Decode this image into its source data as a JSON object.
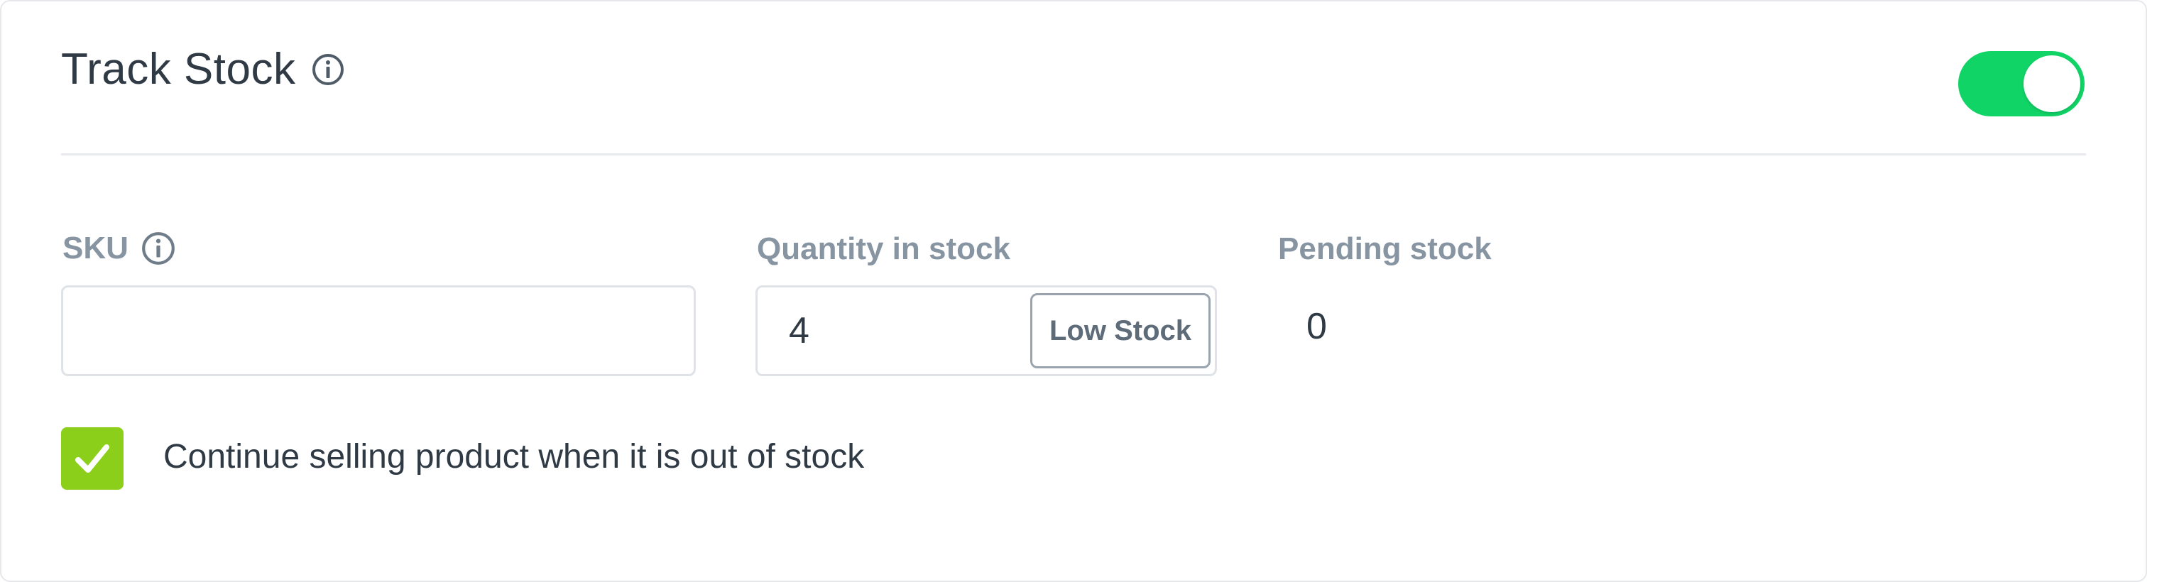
{
  "section": {
    "title": "Track Stock",
    "title_info_icon": "info-circle-icon",
    "toggle": {
      "state": "on",
      "color": "#11d467"
    }
  },
  "fields": {
    "sku": {
      "label": "SKU",
      "info_icon": "info-circle-icon",
      "value": "",
      "placeholder": ""
    },
    "quantity": {
      "label": "Quantity in stock",
      "value": "4",
      "low_stock_button": "Low Stock"
    },
    "pending": {
      "label": "Pending stock",
      "value": "0"
    }
  },
  "continue_selling": {
    "checked": true,
    "label": "Continue selling product when it is out of stock",
    "color": "#8ccf1b"
  }
}
